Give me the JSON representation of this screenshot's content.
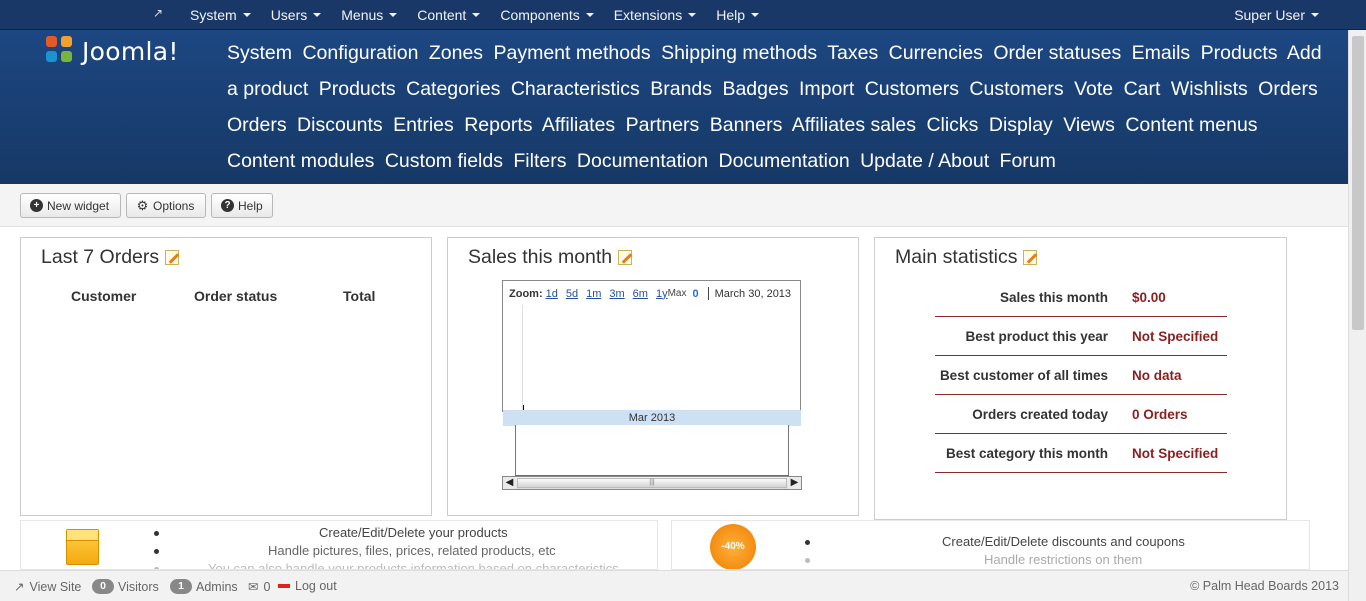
{
  "topbar": {
    "menus": [
      "System",
      "Users",
      "Menus",
      "Content",
      "Components",
      "Extensions",
      "Help"
    ],
    "user": "Super User"
  },
  "header": {
    "logo_text": "Joomla!",
    "submenu": [
      "System",
      "Configuration",
      "Zones",
      "Payment methods",
      "Shipping methods",
      "Taxes",
      "Currencies",
      "Order statuses",
      "Emails",
      "Products",
      "Add a product",
      "Products",
      "Categories",
      "Characteristics",
      "Brands",
      "Badges",
      "Import",
      "Customers",
      "Customers",
      "Vote",
      "Cart",
      "Wishlists",
      "Orders",
      "Orders",
      "Discounts",
      "Entries",
      "Reports",
      "Affiliates",
      "Partners",
      "Banners",
      "Affiliates sales",
      "Clicks",
      "Display",
      "Views",
      "Content menus",
      "Content modules",
      "Custom fields",
      "Filters",
      "Documentation",
      "Documentation",
      "Update / About",
      "Forum"
    ]
  },
  "toolbar": {
    "new_widget": "New widget",
    "options": "Options",
    "help": "Help"
  },
  "widgets": {
    "orders": {
      "title": "Last 7 Orders",
      "columns": [
        "Customer",
        "Order status",
        "Total"
      ]
    },
    "sales": {
      "title": "Sales this month",
      "zoom_label": "Zoom:",
      "zoom_options": [
        "1d",
        "5d",
        "1m",
        "3m",
        "6m",
        "1y"
      ],
      "max_label": "Max",
      "value": "0",
      "date": "March 30, 2013",
      "period": "Mar 2013"
    },
    "stats": {
      "title": "Main statistics",
      "rows": [
        {
          "label": "Sales this month",
          "value": "$0.00"
        },
        {
          "label": "Best product this year",
          "value": "Not Specified"
        },
        {
          "label": "Best customer of all times",
          "value": "No data"
        },
        {
          "label": "Orders created today",
          "value": "0 Orders"
        },
        {
          "label": "Best category this month",
          "value": "Not Specified"
        }
      ]
    }
  },
  "features": {
    "products": [
      "Create/Edit/Delete your products",
      "Handle pictures, files, prices, related products, etc",
      "You can also handle your products information based on characteristics"
    ],
    "discounts": {
      "badge": "-40%",
      "items": [
        "Create/Edit/Delete discounts and coupons",
        "Handle restrictions on them"
      ]
    }
  },
  "statusbar": {
    "view_site": "View Site",
    "visitors_count": "0",
    "visitors": "Visitors",
    "admins_count": "1",
    "admins": "Admins",
    "messages": "0",
    "logout": "Log out",
    "copyright": "© Palm Head Boards 2013"
  }
}
